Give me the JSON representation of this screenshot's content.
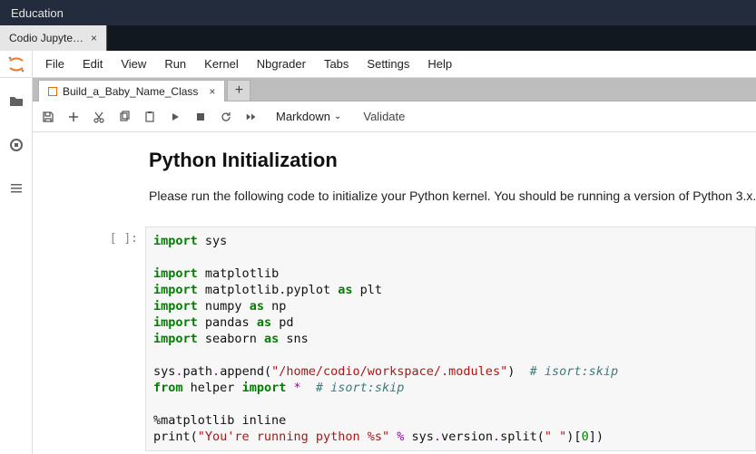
{
  "topbar": {
    "title": "Education"
  },
  "app_tab": {
    "label": "Codio Jupyte…"
  },
  "menu": {
    "items": [
      "File",
      "Edit",
      "View",
      "Run",
      "Kernel",
      "Nbgrader",
      "Tabs",
      "Settings",
      "Help"
    ]
  },
  "file_tab": {
    "label": "Build_a_Baby_Name_Class"
  },
  "toolbar": {
    "cell_type": "Markdown",
    "validate_label": "Validate"
  },
  "notebook": {
    "heading": "Python Initialization",
    "paragraph": "Please run the following code to initialize your Python kernel. You should be running a version of Python 3.x.",
    "prompt": "[ ]:",
    "code_tokens": {
      "import": "import",
      "as": "as",
      "from": "from",
      "sys": "sys",
      "matplotlib": "matplotlib",
      "matplotlib_pyplot": "matplotlib.pyplot",
      "plt": "plt",
      "numpy": "numpy",
      "np": "np",
      "pandas": "pandas",
      "pd": "pd",
      "seaborn": "seaborn",
      "sns": "sns",
      "sys_path": "sys",
      "dot": ".",
      "path": "path",
      "append": "append",
      "lpar": "(",
      "rpar": ")",
      "workspace_str": "\"/home/codio/workspace/.modules\"",
      "isort_comment": "# isort:skip",
      "helper": "helper",
      "star": "*",
      "magic": "%matplotlib inline",
      "print": "print",
      "run_str": "\"You're running python %s\"",
      "percent": "%",
      "version": "version",
      "split": "split",
      "space_str": "\" \"",
      "lbr": "[",
      "rbr": "]",
      "zero": "0"
    }
  }
}
